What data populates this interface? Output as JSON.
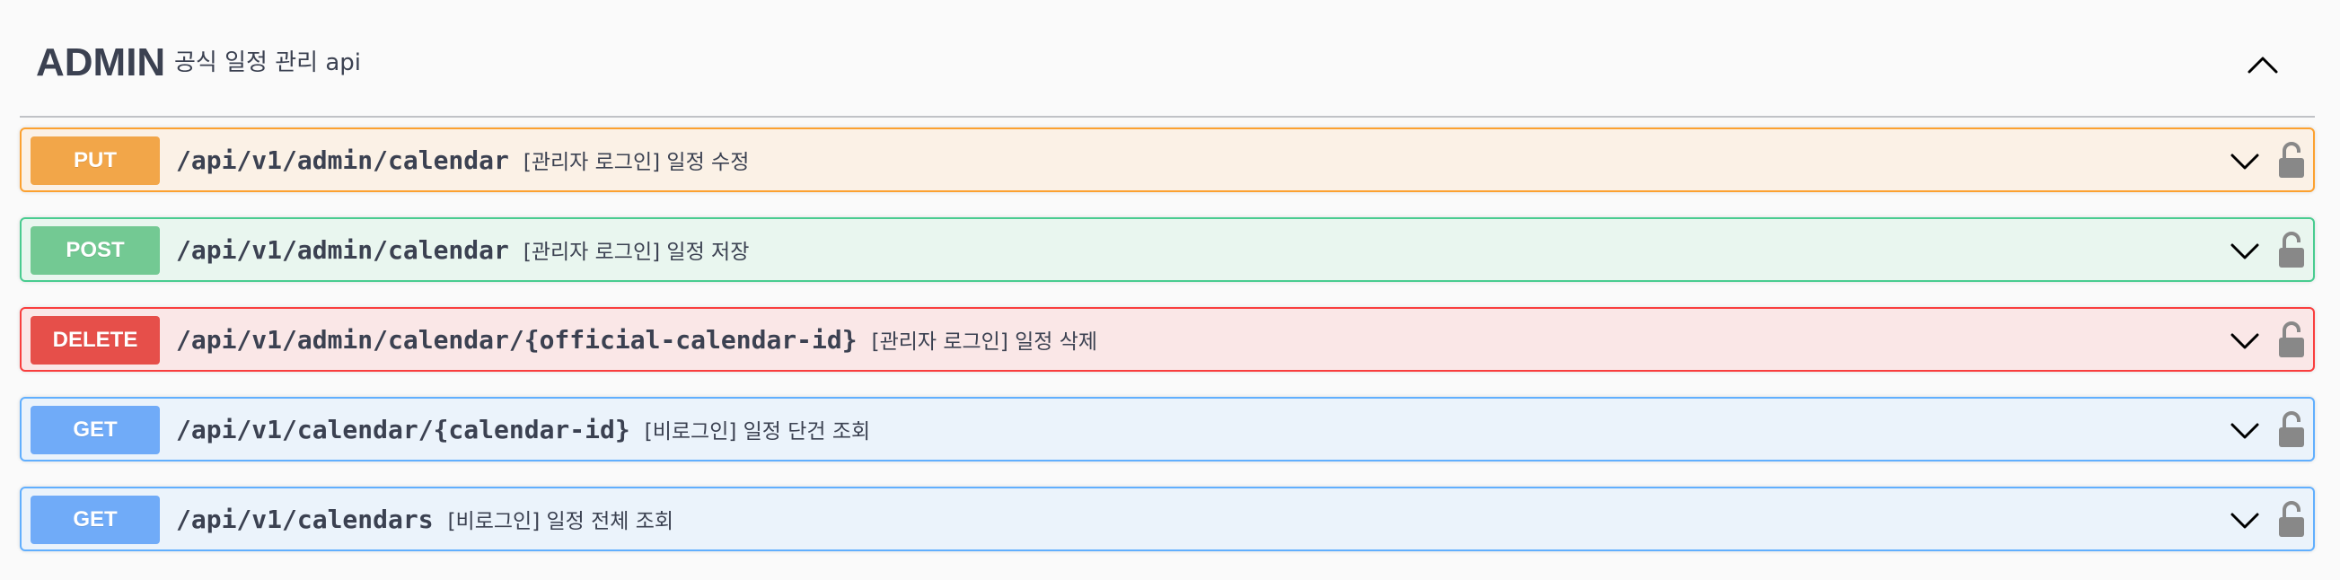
{
  "tag": {
    "name": "ADMIN",
    "description": "공식 일정 관리 api"
  },
  "operations": [
    {
      "method": "PUT",
      "path": "/api/v1/admin/calendar",
      "summary": "[관리자 로그인] 일정 수정"
    },
    {
      "method": "POST",
      "path": "/api/v1/admin/calendar",
      "summary": "[관리자 로그인] 일정 저장"
    },
    {
      "method": "DELETE",
      "path": "/api/v1/admin/calendar/{official-calendar-id}",
      "summary": "[관리자 로그인] 일정 삭제"
    },
    {
      "method": "GET",
      "path": "/api/v1/calendar/{calendar-id}",
      "summary": "[비로그인] 일정 단건 조회"
    },
    {
      "method": "GET",
      "path": "/api/v1/calendars",
      "summary": "[비로그인] 일정 전체 조회"
    }
  ],
  "icons": {
    "collapse": "chevron-up-icon",
    "expand": "chevron-down-icon",
    "auth": "lock-icon"
  },
  "colors": {
    "put": "#fca130",
    "post": "#49cc90",
    "delete": "#f93e3e",
    "get": "#61affe",
    "text": "#3b4151"
  }
}
